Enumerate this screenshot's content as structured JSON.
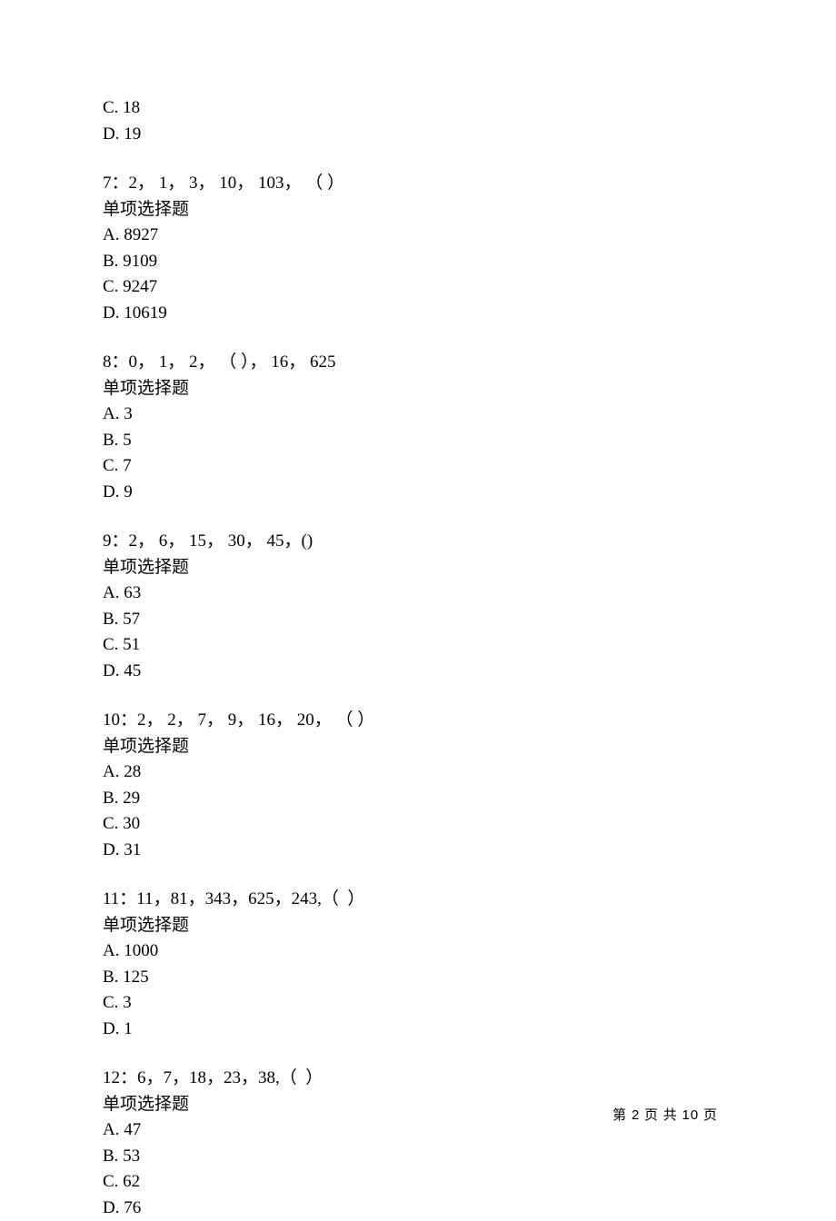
{
  "residual": {
    "c": "C. 18",
    "d": "D. 19"
  },
  "questions": [
    {
      "prompt": "7：2， 1， 3， 10， 103， （ ）",
      "type": "单项选择题",
      "options": [
        "A. 8927",
        "B. 9109",
        "C. 9247",
        "D. 10619"
      ]
    },
    {
      "prompt": "8：0， 1， 2， （ ）， 16， 625",
      "type": "单项选择题",
      "options": [
        "A. 3",
        "B. 5",
        "C. 7",
        "D. 9"
      ]
    },
    {
      "prompt": "9：2， 6， 15， 30， 45，()",
      "type": "单项选择题",
      "options": [
        "A. 63",
        "B. 57",
        "C. 51",
        "D. 45"
      ]
    },
    {
      "prompt": "10：2， 2， 7， 9， 16， 20， （ ）",
      "type": "单项选择题",
      "options": [
        "A. 28",
        "B. 29",
        "C. 30",
        "D. 31"
      ]
    },
    {
      "prompt": "11：11，81，343，625，243,（  ）",
      "type": "单项选择题",
      "options": [
        "A. 1000",
        "B. 125",
        "C. 3",
        "D. 1"
      ]
    },
    {
      "prompt": "12：6，7，18，23，38,（  ）",
      "type": "单项选择题",
      "options": [
        "A. 47",
        "B. 53",
        "C. 62",
        "D. 76"
      ]
    }
  ],
  "footer": {
    "label_prefix": "第 ",
    "current": "2",
    "label_mid": " 页 共 ",
    "total": "10",
    "label_suffix": " 页"
  }
}
